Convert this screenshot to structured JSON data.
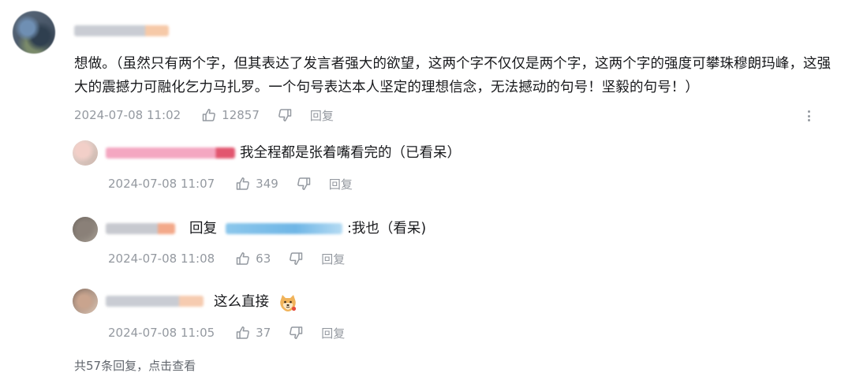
{
  "main_comment": {
    "text": "想做。（虽然只有两个字，但其表达了发言者强大的欲望，这两个字不仅仅是两个字，这两个字的强度可攀珠穆朗玛峰，这强大的震撼力可融化乞力马扎罗。一个句号表达本人坚定的理想信念，无法撼动的句号！坚毅的句号！）",
    "date": "2024-07-08 11:02",
    "likes": "12857",
    "reply_label": "回复"
  },
  "replies": [
    {
      "text": "我全程都是张着嘴看完的（已看呆）",
      "date": "2024-07-08 11:07",
      "likes": "349",
      "reply_label": "回复"
    },
    {
      "prefix": "回复",
      "text": ":我也（看呆)",
      "date": "2024-07-08 11:08",
      "likes": "63",
      "reply_label": "回复"
    },
    {
      "text": "这么直接",
      "date": "2024-07-08 11:05",
      "likes": "37",
      "reply_label": "回复"
    }
  ],
  "view_all": "共57条回复，点击查看",
  "colors": {
    "text": "#18191c",
    "meta": "#9499a0",
    "link": "#61666d"
  },
  "icons": {
    "like": "thumbs-up-icon",
    "dislike": "thumbs-down-icon",
    "more": "more-vertical-icon",
    "emoji": "shiba-dog-emoji-icon"
  }
}
